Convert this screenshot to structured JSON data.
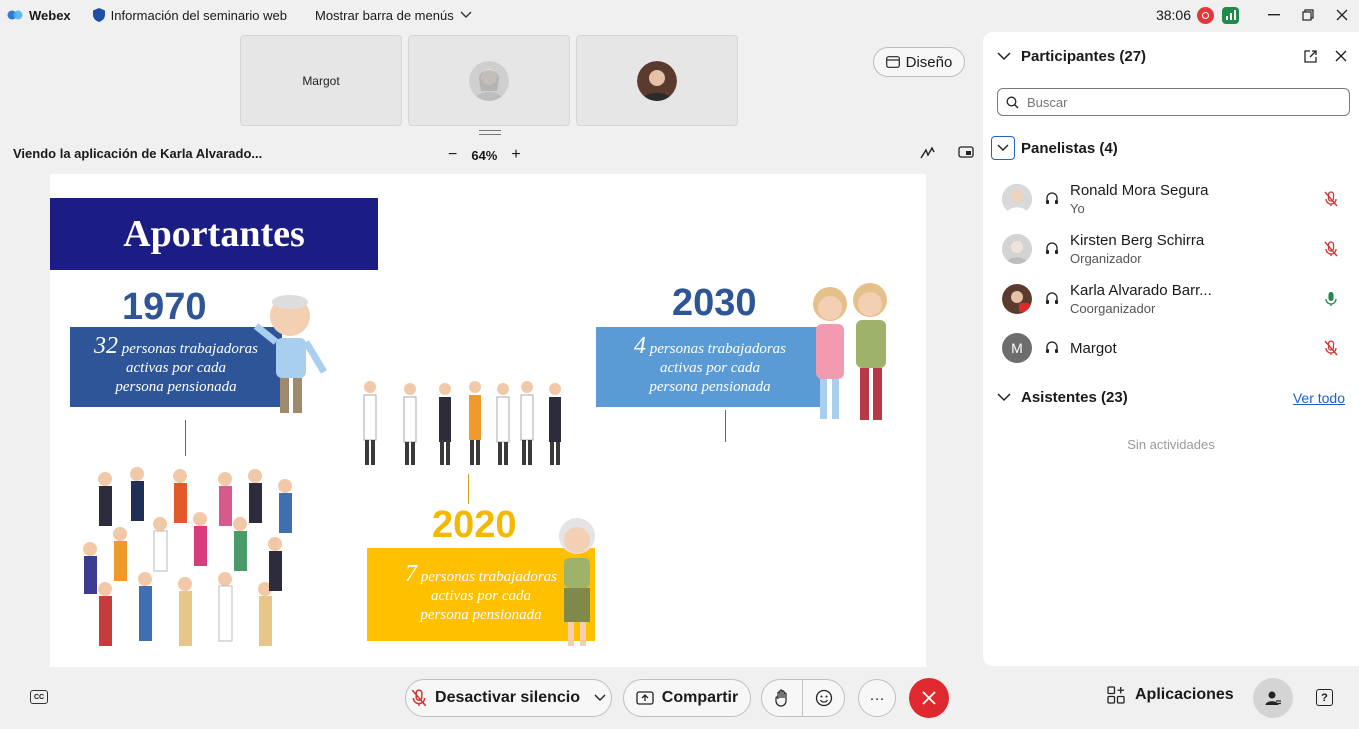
{
  "topbar": {
    "app_name": "Webex",
    "seminar_info": "Información del seminario web",
    "menu_toggle": "Mostrar barra de menús",
    "timer": "38:06"
  },
  "thumbnails": [
    {
      "name": "Margot"
    }
  ],
  "design_button": "Diseño",
  "viewing": {
    "label": "Viendo la aplicación de Karla Alvarado...",
    "zoom": "64%",
    "zoom_out": "−",
    "zoom_in": "+"
  },
  "slide": {
    "title": "Aportantes",
    "blocks": [
      {
        "year": "1970",
        "number": "32",
        "line1": " personas trabajadoras",
        "line2": "activas por cada",
        "line3": "persona pensionada",
        "color": "#2d5597",
        "year_color": "#2d5597"
      },
      {
        "year": "2030",
        "number": "4",
        "line1": " personas trabajadoras",
        "line2": "activas por cada",
        "line3": "persona pensionada",
        "color": "#5b9bd5",
        "year_color": "#2d5597"
      },
      {
        "year": "2020",
        "number": "7",
        "line1": " personas trabajadoras",
        "line2": "activas por cada",
        "line3": "persona pensionada",
        "color": "#ffc000",
        "year_color": "#f5b800"
      }
    ]
  },
  "panel": {
    "title": "Participantes (27)",
    "search_placeholder": "Buscar",
    "panelists_header": "Panelistas (4)",
    "panelists": [
      {
        "name": "Ronald Mora Segura",
        "role": "Yo",
        "mic": "muted"
      },
      {
        "name": "Kirsten Berg Schirra",
        "role": "Organizador",
        "mic": "muted"
      },
      {
        "name": "Karla Alvarado Barr...",
        "role": "Coorganizador",
        "mic": "active"
      },
      {
        "name": "Margot",
        "role": "",
        "mic": "muted",
        "initial": "M"
      }
    ],
    "attendees_header": "Asistentes (23)",
    "see_all": "Ver todo",
    "empty": "Sin actividades"
  },
  "bottombar": {
    "mute_label": "Desactivar silencio",
    "share_label": "Compartir",
    "more_label": "···",
    "apps_label": "Aplicaciones",
    "cc_label": "CC",
    "help_label": "?"
  },
  "colors": {
    "accent": "#1e62c9",
    "end_call": "#e0282f",
    "title_bg": "#1b1c84",
    "muted_mic": "#d23434",
    "active_mic": "#1f8a4c"
  }
}
